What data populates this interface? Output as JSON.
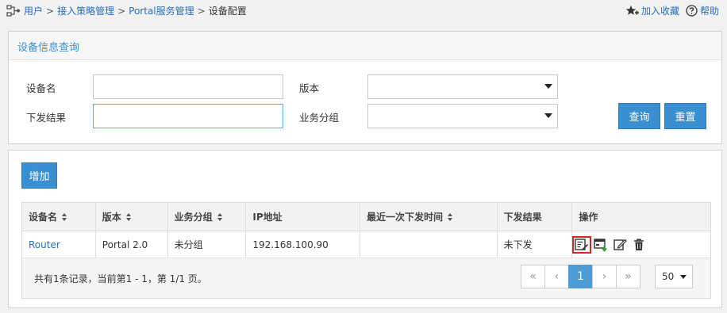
{
  "breadcrumb": {
    "items": [
      "用户",
      "接入策略管理",
      "Portal服务管理"
    ],
    "current": "设备配置",
    "separator": ">"
  },
  "toolbar": {
    "favorite_label": "加入收藏",
    "help_label": "帮助"
  },
  "query_panel": {
    "title": "设备信息查询",
    "device_name_label": "设备名",
    "device_name_value": "",
    "version_label": "版本",
    "version_value": "",
    "result_label": "下发结果",
    "result_value": "",
    "group_label": "业务分组",
    "group_value": "",
    "search_label": "查询",
    "reset_label": "重置"
  },
  "list_panel": {
    "add_label": "增加",
    "columns": [
      "设备名",
      "版本",
      "业务分组",
      "IP地址",
      "最近一次下发时间",
      "下发结果",
      "操作"
    ],
    "rows": [
      {
        "name": "Router",
        "version": "Portal 2.0",
        "group": "未分组",
        "ip": "192.168.100.90",
        "last_time": "",
        "result": "未下发",
        "actions": [
          "deploy-config-icon",
          "deploy-device-icon",
          "edit-icon",
          "delete-icon"
        ]
      }
    ],
    "summary": "共有1条记录，当前第1 - 1，第 1/1 页。",
    "pager": {
      "first": "«",
      "prev": "‹",
      "page": "1",
      "next": "›",
      "last": "»"
    },
    "page_size": "50"
  },
  "colors": {
    "accent": "#3a8fd1",
    "link": "#2a6ebb",
    "selected_outline": "#d9261c"
  }
}
